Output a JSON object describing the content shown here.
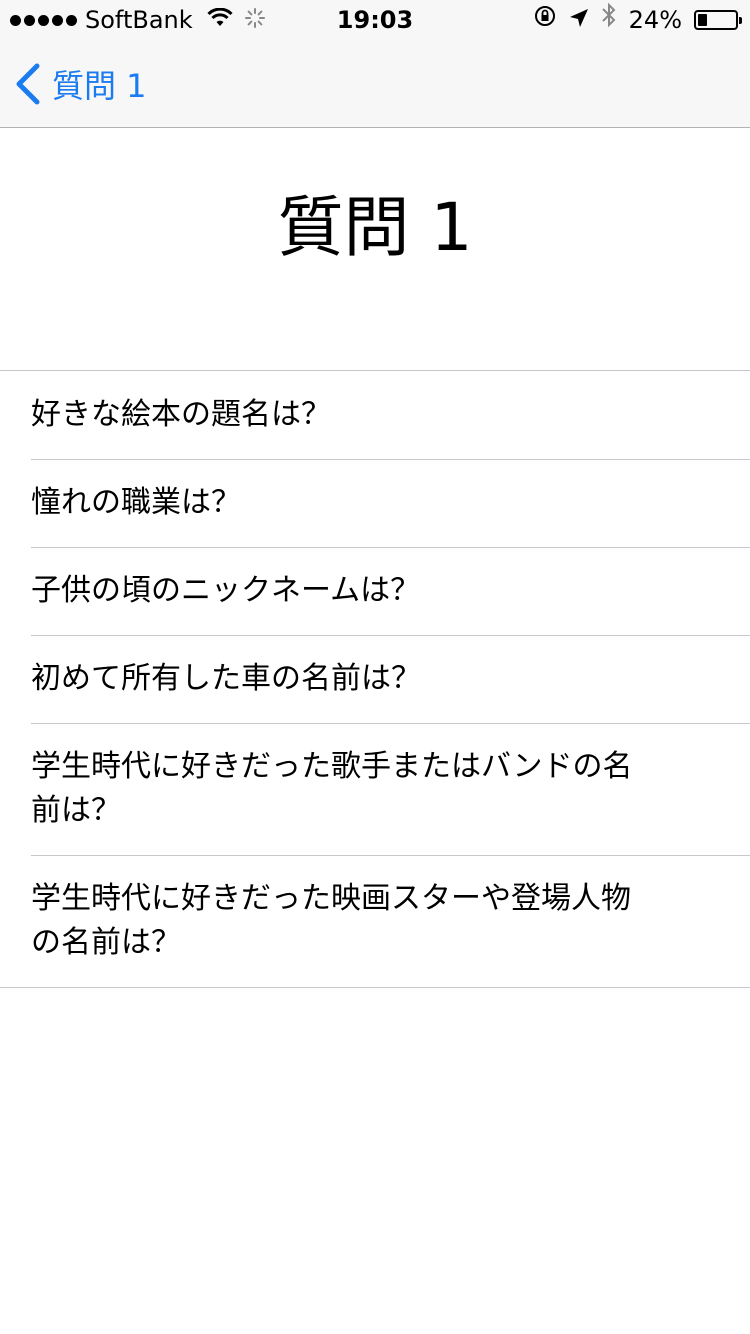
{
  "status_bar": {
    "carrier": "SoftBank",
    "time": "19:03",
    "battery_percent": "24%",
    "battery_level": 0.24,
    "icons": [
      "wifi-icon",
      "activity-spinner-icon",
      "orientation-lock-icon",
      "location-arrow-icon",
      "bluetooth-icon",
      "battery-icon"
    ]
  },
  "nav": {
    "back_label": "質問 1"
  },
  "page": {
    "title": "質問 1"
  },
  "questions": [
    "好きな絵本の題名は？",
    "憧れの職業は？",
    "子供の頃のニックネームは？",
    "初めて所有した車の名前は？",
    "学生時代に好きだった歌手またはバンドの名前は？",
    "学生時代に好きだった映画スターや登場人物の名前は？"
  ],
  "colors": {
    "accent": "#1a7cf0",
    "separator": "#c8c7cc",
    "bar_background": "#f7f7f7"
  }
}
